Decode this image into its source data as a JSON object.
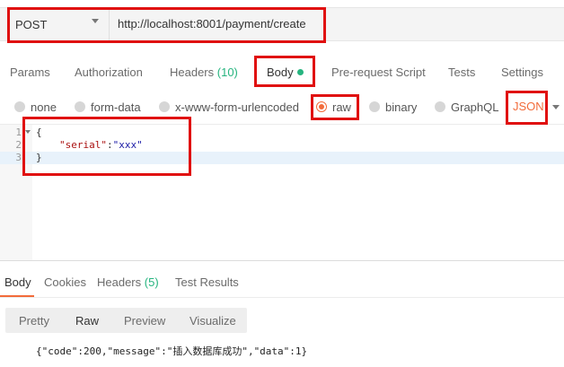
{
  "request": {
    "method": "POST",
    "url": "http://localhost:8001/payment/create"
  },
  "request_tabs": [
    {
      "label": "Params"
    },
    {
      "label": "Authorization"
    },
    {
      "label": "Headers",
      "count": "(10)"
    },
    {
      "label": "Body"
    },
    {
      "label": "Pre-request Script"
    },
    {
      "label": "Tests"
    },
    {
      "label": "Settings"
    }
  ],
  "body_types": [
    {
      "label": "none"
    },
    {
      "label": "form-data"
    },
    {
      "label": "x-www-form-urlencoded"
    },
    {
      "label": "raw"
    },
    {
      "label": "binary"
    },
    {
      "label": "GraphQL"
    }
  ],
  "body_language": "JSON",
  "editor": {
    "lines": [
      {
        "num": "1",
        "open": "{"
      },
      {
        "num": "2",
        "key": "\"serial\"",
        "sep": ":",
        "value": "\"xxx\""
      },
      {
        "num": "3",
        "close": "}"
      }
    ]
  },
  "response_tabs": [
    {
      "label": "Body"
    },
    {
      "label": "Cookies"
    },
    {
      "label": "Headers",
      "count": "(5)"
    },
    {
      "label": "Test Results"
    }
  ],
  "view_modes": [
    {
      "label": "Pretty"
    },
    {
      "label": "Raw"
    },
    {
      "label": "Preview"
    },
    {
      "label": "Visualize"
    }
  ],
  "response_body": "{\"code\":200,\"message\":\"插入数据库成功\",\"data\":1}",
  "colors": {
    "accent": "#f26b3a",
    "success": "#26b47f",
    "annotation": "#e01010"
  }
}
